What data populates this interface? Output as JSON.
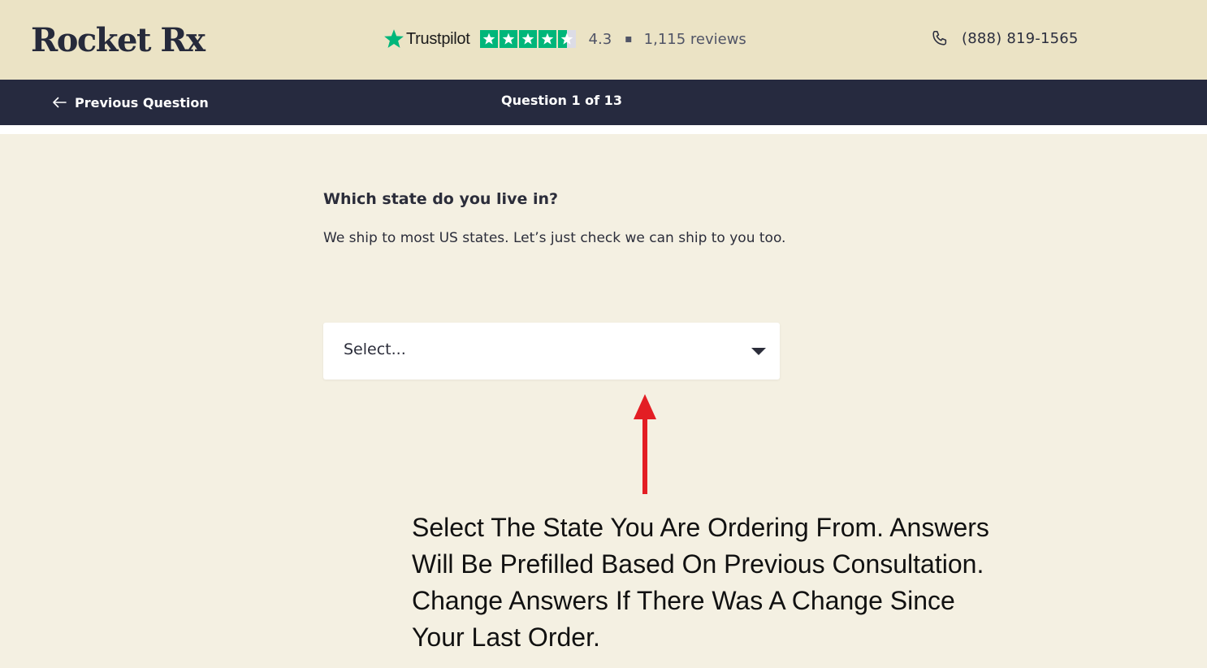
{
  "header": {
    "logo": "Rocket Rx",
    "trustpilot": {
      "name": "Trustpilot",
      "rating": "4.3",
      "separator": "▪",
      "reviews": "1,115 reviews",
      "stars_filled": 4.5
    },
    "phone": "(888) 819-1565"
  },
  "nav": {
    "previous_label": "Previous Question",
    "question_counter": "Question 1 of 13"
  },
  "question": {
    "title": "Which state do you live in?",
    "subtitle": "We ship to most US states. Let’s just check we can ship to you too.",
    "select_value": "Select..."
  },
  "annotation": {
    "text": "Select The State You Are Ordering From. Answers Will Be Prefilled Based On Previous Consultation. Change Answers If There Was A Change Since Your Last Order."
  },
  "colors": {
    "header_bg": "#ebe3c5",
    "nav_bg": "#262a3f",
    "page_bg": "#f4f0e2",
    "trustpilot_green": "#00b67a",
    "arrow_red": "#e31e24"
  },
  "icons": {
    "back": "arrow-left-icon",
    "phone": "phone-icon",
    "trustpilot": "star-icon",
    "dropdown": "chevron-down-icon"
  }
}
